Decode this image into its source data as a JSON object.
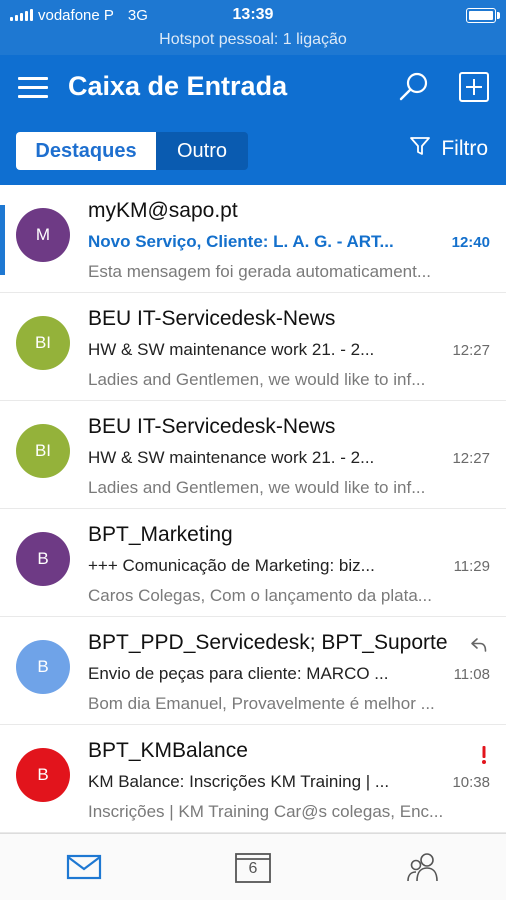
{
  "status_bar": {
    "carrier": "vodafone P",
    "network": "3G",
    "time": "13:39",
    "hotspot": "Hotspot pessoal: 1 ligação"
  },
  "header": {
    "title": "Caixa de Entrada",
    "tabs": {
      "focused": "Destaques",
      "other": "Outro"
    },
    "filter_label": "Filtro"
  },
  "colors": {
    "accent": "#0f6fd1",
    "unread": "#1470cc"
  },
  "emails": [
    {
      "initials": "M",
      "avatar_color": "#6e3a85",
      "sender": "myKM@sapo.pt",
      "subject": "Novo Serviço, Cliente: L. A. G. - ART...",
      "time": "12:40",
      "preview": "Esta mensagem foi gerada automaticament...",
      "unread": true
    },
    {
      "initials": "BI",
      "avatar_color": "#94b23a",
      "sender": "BEU IT-Servicedesk-News",
      "subject": "HW & SW maintenance work 21. - 2...",
      "time": "12:27",
      "preview": "Ladies and Gentlemen, we would like to inf...",
      "unread": false
    },
    {
      "initials": "BI",
      "avatar_color": "#94b23a",
      "sender": "BEU IT-Servicedesk-News",
      "subject": "HW & SW maintenance work 21. - 2...",
      "time": "12:27",
      "preview": "Ladies and Gentlemen, we would like to inf...",
      "unread": false
    },
    {
      "initials": "B",
      "avatar_color": "#6e3a85",
      "sender": "BPT_Marketing",
      "subject": "+++ Comunicação de Marketing: biz...",
      "time": "11:29",
      "preview": "Caros Colegas, Com o lançamento da plata...",
      "unread": false
    },
    {
      "initials": "B",
      "avatar_color": "#6fa3e8",
      "sender": "BPT_PPD_Servicedesk; BPT_Suporte",
      "subject": "Envio de peças para cliente: MARCO ...",
      "time": "11:08",
      "preview": "Bom dia Emanuel, Provavelmente é melhor ...",
      "unread": false,
      "replied": true
    },
    {
      "initials": "B",
      "avatar_color": "#e2141c",
      "sender": "BPT_KMBalance",
      "subject": "KM Balance: Inscrições KM Training | ...",
      "time": "10:38",
      "preview": "Inscrições | KM Training Car@s colegas, Enc...",
      "unread": false,
      "important": true
    }
  ],
  "tabbar": {
    "mail_icon": "mail-icon",
    "calendar_day": "6",
    "people_icon": "people-icon"
  }
}
